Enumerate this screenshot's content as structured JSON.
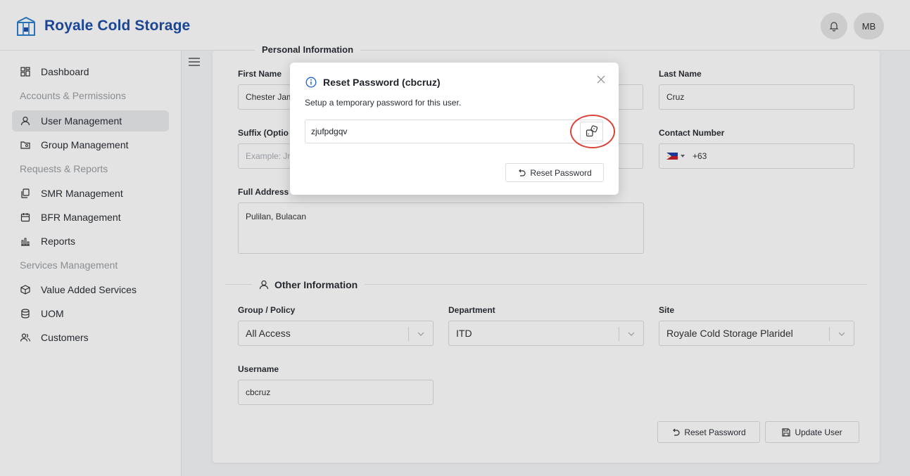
{
  "app": {
    "brand": "Royale Cold Storage",
    "avatar_initials": "MB",
    "accent": "#1e4fa8"
  },
  "sidebar": {
    "items": [
      {
        "label": "Dashboard",
        "icon": "dashboard-icon"
      },
      {
        "group": "Accounts & Permissions"
      },
      {
        "label": "User Management",
        "icon": "user-icon",
        "active": true
      },
      {
        "label": "Group Management",
        "icon": "group-folder-icon"
      },
      {
        "group": "Requests & Reports"
      },
      {
        "label": "SMR Management",
        "icon": "copy-icon"
      },
      {
        "label": "BFR Management",
        "icon": "calendar-icon"
      },
      {
        "label": "Reports",
        "icon": "bar-chart-icon"
      },
      {
        "group": "Services Management"
      },
      {
        "label": "Value Added Services",
        "icon": "box-icon"
      },
      {
        "label": "UOM",
        "icon": "database-icon"
      },
      {
        "label": "Customers",
        "icon": "users-icon"
      }
    ]
  },
  "form": {
    "section_personal": "Personal Information",
    "first_name_label": "First Name",
    "first_name_value": "Chester Jam",
    "last_name_label": "Last Name",
    "last_name_value": "Cruz",
    "suffix_label": "Suffix (Optio",
    "suffix_placeholder": "Example: Jr,",
    "contact_label": "Contact Number",
    "contact_prefix": "+63",
    "address_label": "Full Address",
    "address_value": "Pulilan, Bulacan",
    "section_other": "Other Information",
    "group_label": "Group / Policy",
    "group_value": "All Access",
    "department_label": "Department",
    "department_value": "ITD",
    "site_label": "Site",
    "site_value": "Royale Cold Storage Plaridel",
    "username_label": "Username",
    "username_value": "cbcruz",
    "reset_button": "Reset Password",
    "update_button": "Update User"
  },
  "modal": {
    "title": "Reset Password (cbcruz)",
    "description": "Setup a temporary password for this user.",
    "password_value": "zjufpdgqv",
    "reset_button": "Reset Password",
    "highlight_color": "#d9433a"
  }
}
